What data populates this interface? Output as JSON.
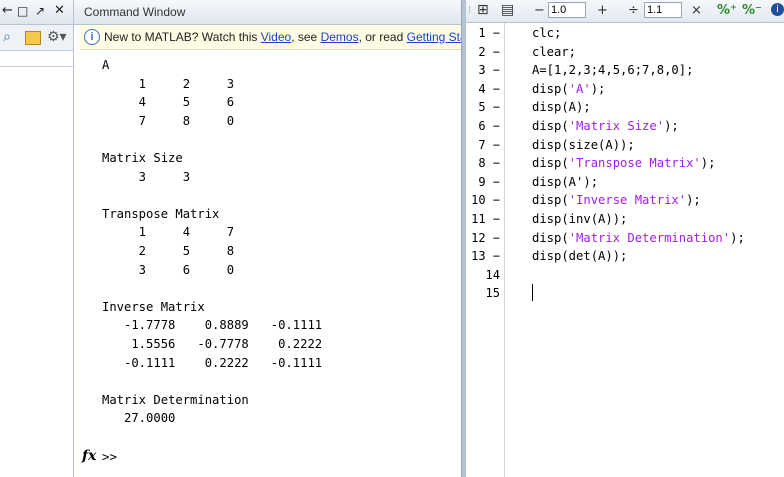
{
  "left_panel": {
    "icons": [
      "arrow-left-icon",
      "restore-icon",
      "undock-icon",
      "close-icon",
      "search-icon",
      "folder-up-icon",
      "gear-icon"
    ]
  },
  "command_window": {
    "title": "Command Window",
    "info": {
      "prefix": "New to MATLAB? Watch this ",
      "video_link": "Video",
      "sep1": ", see ",
      "demos_link": "Demos",
      "sep2": ", or read ",
      "getting_started_link": "Getting Started"
    },
    "output_lines": [
      "A",
      "     1     2     3",
      "     4     5     6",
      "     7     8     0",
      "",
      "Matrix Size",
      "     3     3",
      "",
      "Transpose Matrix",
      "     1     4     7",
      "     2     5     8",
      "     3     6     0",
      "",
      "Inverse Matrix",
      "   -1.7778    0.8889   -0.1111",
      "    1.5556   -0.7778    0.2222",
      "   -0.1111    0.2222   -0.1111",
      "",
      "Matrix Determination",
      "   27.0000"
    ],
    "prompt": ">>"
  },
  "editor": {
    "toolbar": {
      "minus": "−",
      "step_value": "1.0",
      "plus": "+",
      "divide": "÷",
      "scale_value": "1.1",
      "close": "×"
    },
    "line_numbers": [
      "1 −",
      "2 −",
      "3 −",
      "4 −",
      "5 −",
      "6 −",
      "7 −",
      "8 −",
      "9 −",
      "10 −",
      "11 −",
      "12 −",
      "13 −",
      "14",
      "15"
    ],
    "code_lines": [
      [
        {
          "t": "clc;",
          "s": false
        }
      ],
      [
        {
          "t": "clear;",
          "s": false
        }
      ],
      [
        {
          "t": "A=[1,2,3;4,5,6;7,8,0];",
          "s": false
        }
      ],
      [
        {
          "t": "disp(",
          "s": false
        },
        {
          "t": "'A'",
          "s": true
        },
        {
          "t": ");",
          "s": false
        }
      ],
      [
        {
          "t": "disp(A);",
          "s": false
        }
      ],
      [
        {
          "t": "disp(",
          "s": false
        },
        {
          "t": "'Matrix Size'",
          "s": true
        },
        {
          "t": ");",
          "s": false
        }
      ],
      [
        {
          "t": "disp(size(A));",
          "s": false
        }
      ],
      [
        {
          "t": "disp(",
          "s": false
        },
        {
          "t": "'Transpose Matrix'",
          "s": true
        },
        {
          "t": ");",
          "s": false
        }
      ],
      [
        {
          "t": "disp(A');",
          "s": false
        }
      ],
      [
        {
          "t": "disp(",
          "s": false
        },
        {
          "t": "'Inverse Matrix'",
          "s": true
        },
        {
          "t": ");",
          "s": false
        }
      ],
      [
        {
          "t": "disp(inv(A));",
          "s": false
        }
      ],
      [
        {
          "t": "disp(",
          "s": false
        },
        {
          "t": "'Matrix Determination'",
          "s": true
        },
        {
          "t": ");",
          "s": false
        }
      ],
      [
        {
          "t": "disp(det(A));",
          "s": false
        }
      ],
      [],
      []
    ],
    "string_color": "#a020f0"
  }
}
